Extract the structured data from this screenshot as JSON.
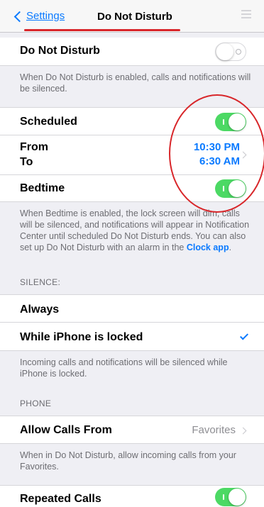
{
  "nav": {
    "back_label": "Settings",
    "title": "Do Not Disturb",
    "right_icon": "settings-sliders-icon"
  },
  "dnd": {
    "label": "Do Not Disturb",
    "enabled": false,
    "caption": "When Do Not Disturb is enabled, calls and notifications will be silenced."
  },
  "scheduled": {
    "label": "Scheduled",
    "enabled": true,
    "from_label": "From",
    "to_label": "To",
    "from_time": "10:30 PM",
    "to_time": "6:30 AM"
  },
  "bedtime": {
    "label": "Bedtime",
    "enabled": true,
    "caption_text": "When Bedtime is enabled, the lock screen will dim, calls will be silenced, and notifications will appear in Notification Center until scheduled Do Not Disturb ends. You can also set up Do Not Disturb with an alarm in the",
    "caption_link": "Clock app",
    "caption_end": "."
  },
  "silence": {
    "header": "SILENCE:",
    "always_label": "Always",
    "locked_label": "While iPhone is locked",
    "selected": "While iPhone is locked",
    "caption": "Incoming calls and notifications will be silenced while iPhone is locked."
  },
  "phone": {
    "header": "PHONE",
    "allow_label": "Allow Calls From",
    "allow_value": "Favorites",
    "caption": "When in Do Not Disturb, allow incoming calls from your Favorites.",
    "repeated_label": "Repeated Calls",
    "repeated_enabled": true
  },
  "colors": {
    "accent": "#0a7aff",
    "toggle_on": "#4cd964",
    "annotation": "#d8262a"
  }
}
